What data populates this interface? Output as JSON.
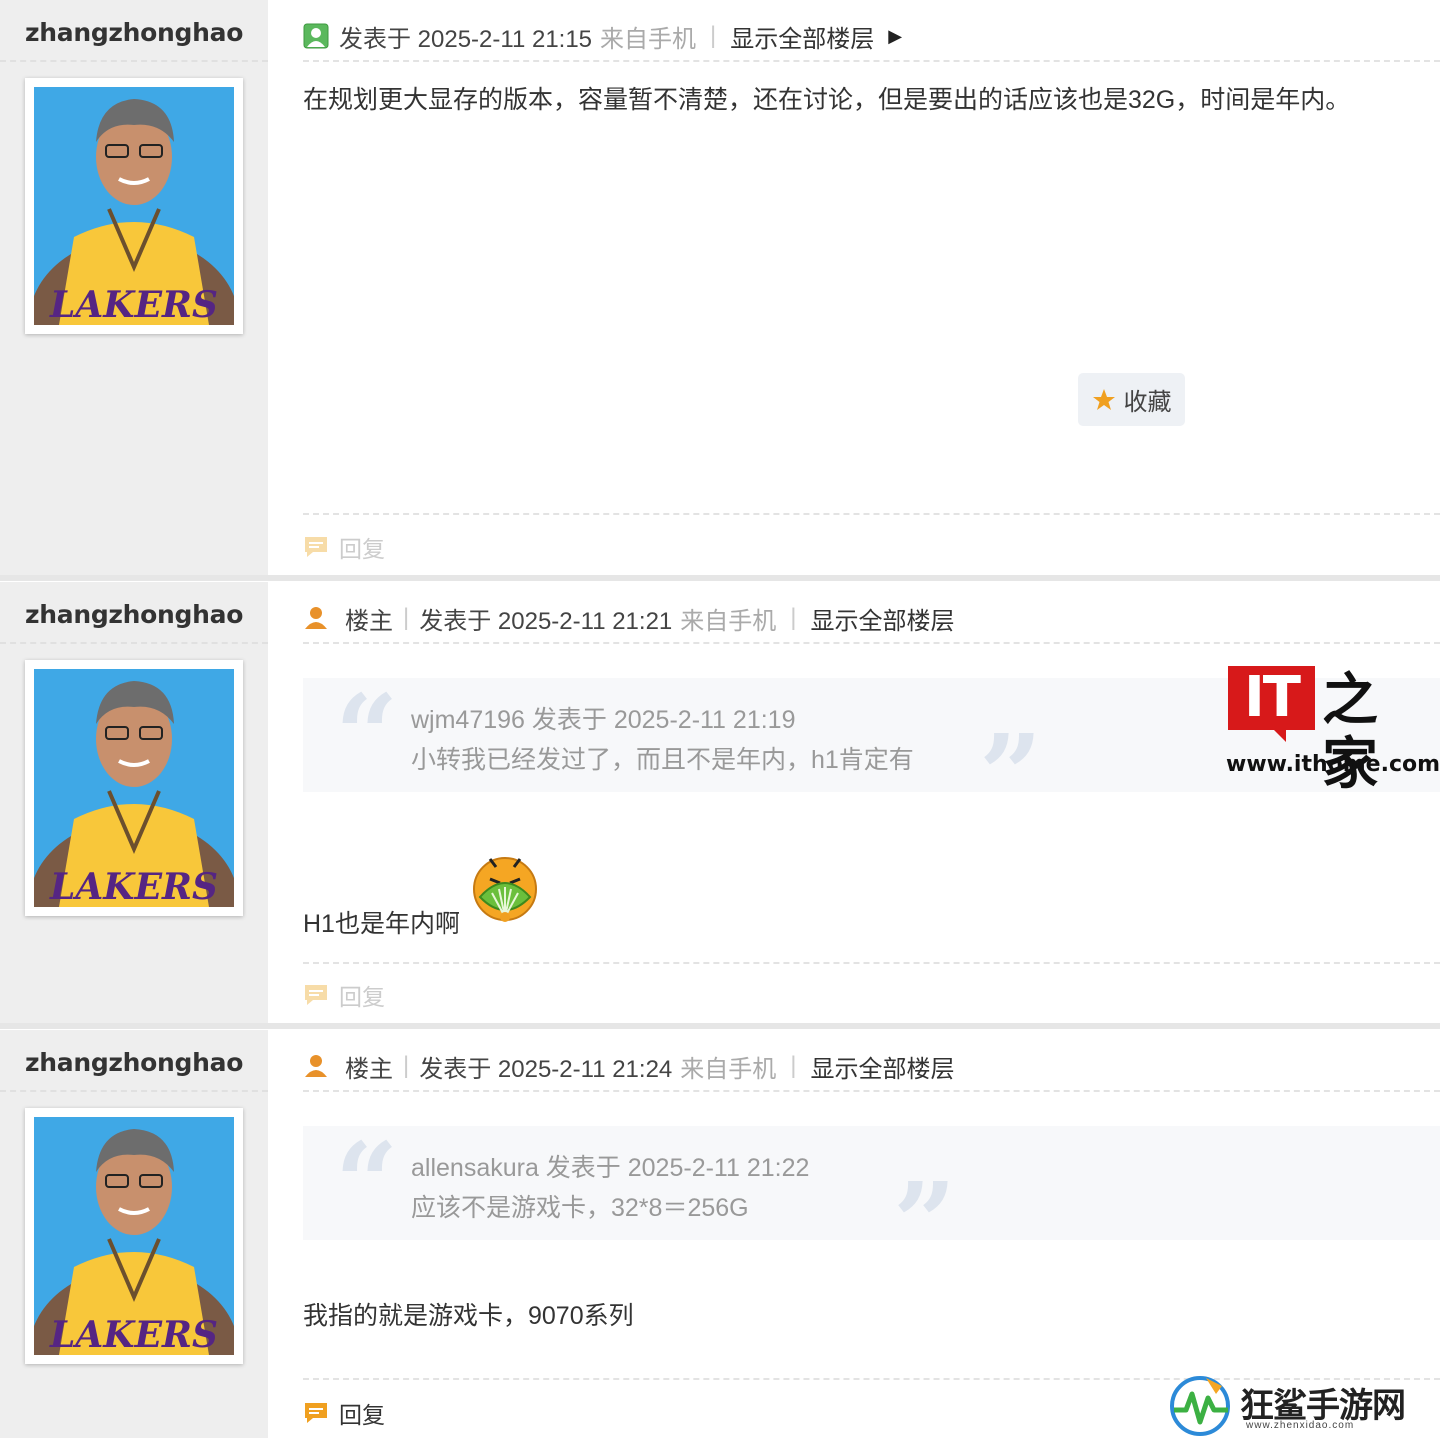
{
  "posts": [
    {
      "username": "zhangzhonghao",
      "is_host": false,
      "host_label": "",
      "posted_label": "发表于 2025-2-11 21:15",
      "source": "来自手机",
      "show_all": "显示全部楼层",
      "body": "在规划更大显存的版本，容量暂不清楚，还在讨论，但是要出的话应该也是32G，时间是年内。",
      "favorite_label": "收藏",
      "reply_label": "回复"
    },
    {
      "username": "zhangzhonghao",
      "is_host": true,
      "host_label": "楼主",
      "posted_label": "发表于 2025-2-11 21:21",
      "source": "来自手机",
      "show_all": "显示全部楼层",
      "quote": {
        "line1": "wjm47196 发表于 2025-2-11 21:19",
        "line2": "小转我已经发过了，而且不是年内，h1肯定有"
      },
      "body": "H1也是年内啊",
      "reply_label": "回复"
    },
    {
      "username": "zhangzhonghao",
      "is_host": true,
      "host_label": "楼主",
      "posted_label": "发表于 2025-2-11 21:24",
      "source": "来自手机",
      "show_all": "显示全部楼层",
      "quote": {
        "line1": "allensakura 发表于 2025-2-11 21:22",
        "line2": "应该不是游戏卡，32*8＝256G"
      },
      "body": "我指的就是游戏卡，9070系列",
      "reply_label": "回复"
    }
  ],
  "watermarks": {
    "ithome_logo_text": "IT",
    "ithome_logo_zh": "之家",
    "ithome_url": "www.ithome.com",
    "site_name": "狂鲨手游网",
    "site_url": "www.zhenxidao.com"
  },
  "colors": {
    "left_bg": "#eeeeee",
    "quote_bg": "#f7f8fa",
    "muted_text": "#aaaaaa",
    "host_icon": "#e8912a",
    "star": "#f0a020",
    "it_red": "#d7191a"
  },
  "icons": {
    "post_icon": "online-user-icon",
    "host_icon": "host-user-icon",
    "favorite_icon": "star-icon",
    "reply_icon": "reply-bubble-icon",
    "emoji": "fan-face-emoji-icon"
  }
}
